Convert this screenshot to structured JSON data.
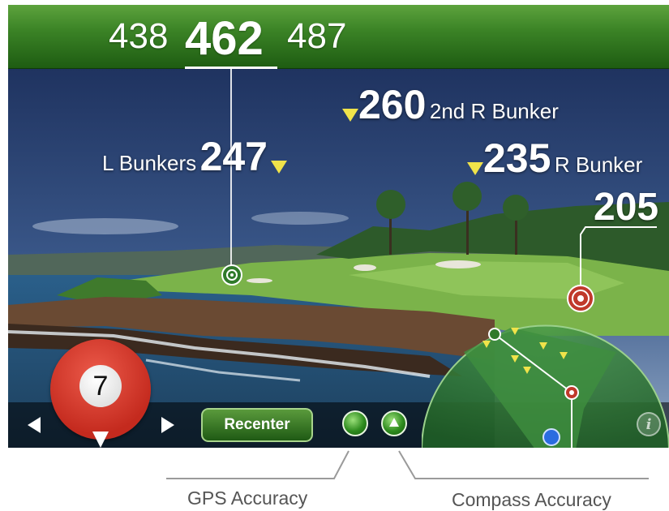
{
  "distances": {
    "front": "438",
    "middle": "462",
    "back": "487"
  },
  "hazards": [
    {
      "side": "left",
      "text": "L Bunkers",
      "value": "247"
    },
    {
      "side": "right",
      "text": "2nd R Bunker",
      "value": "260"
    },
    {
      "side": "right",
      "text": "R Bunker",
      "value": "235"
    }
  ],
  "target_distance": "205",
  "club": {
    "number": "7"
  },
  "buttons": {
    "recenter": "Recenter"
  },
  "info_icon": "i",
  "captions": {
    "gps": "GPS Accuracy",
    "compass": "Compass Accuracy"
  },
  "colors": {
    "bar_green": "#2e7a1e",
    "marker_yellow": "#f0e34a",
    "target_red": "#c0392b",
    "club_red": "#d8382a"
  },
  "icons": [
    "flag-marker-icon",
    "target-icon",
    "left-arrow-icon",
    "right-arrow-icon",
    "gps-accuracy-icon",
    "compass-accuracy-icon",
    "info-icon",
    "user-location-icon",
    "golf-ball-icon"
  ]
}
